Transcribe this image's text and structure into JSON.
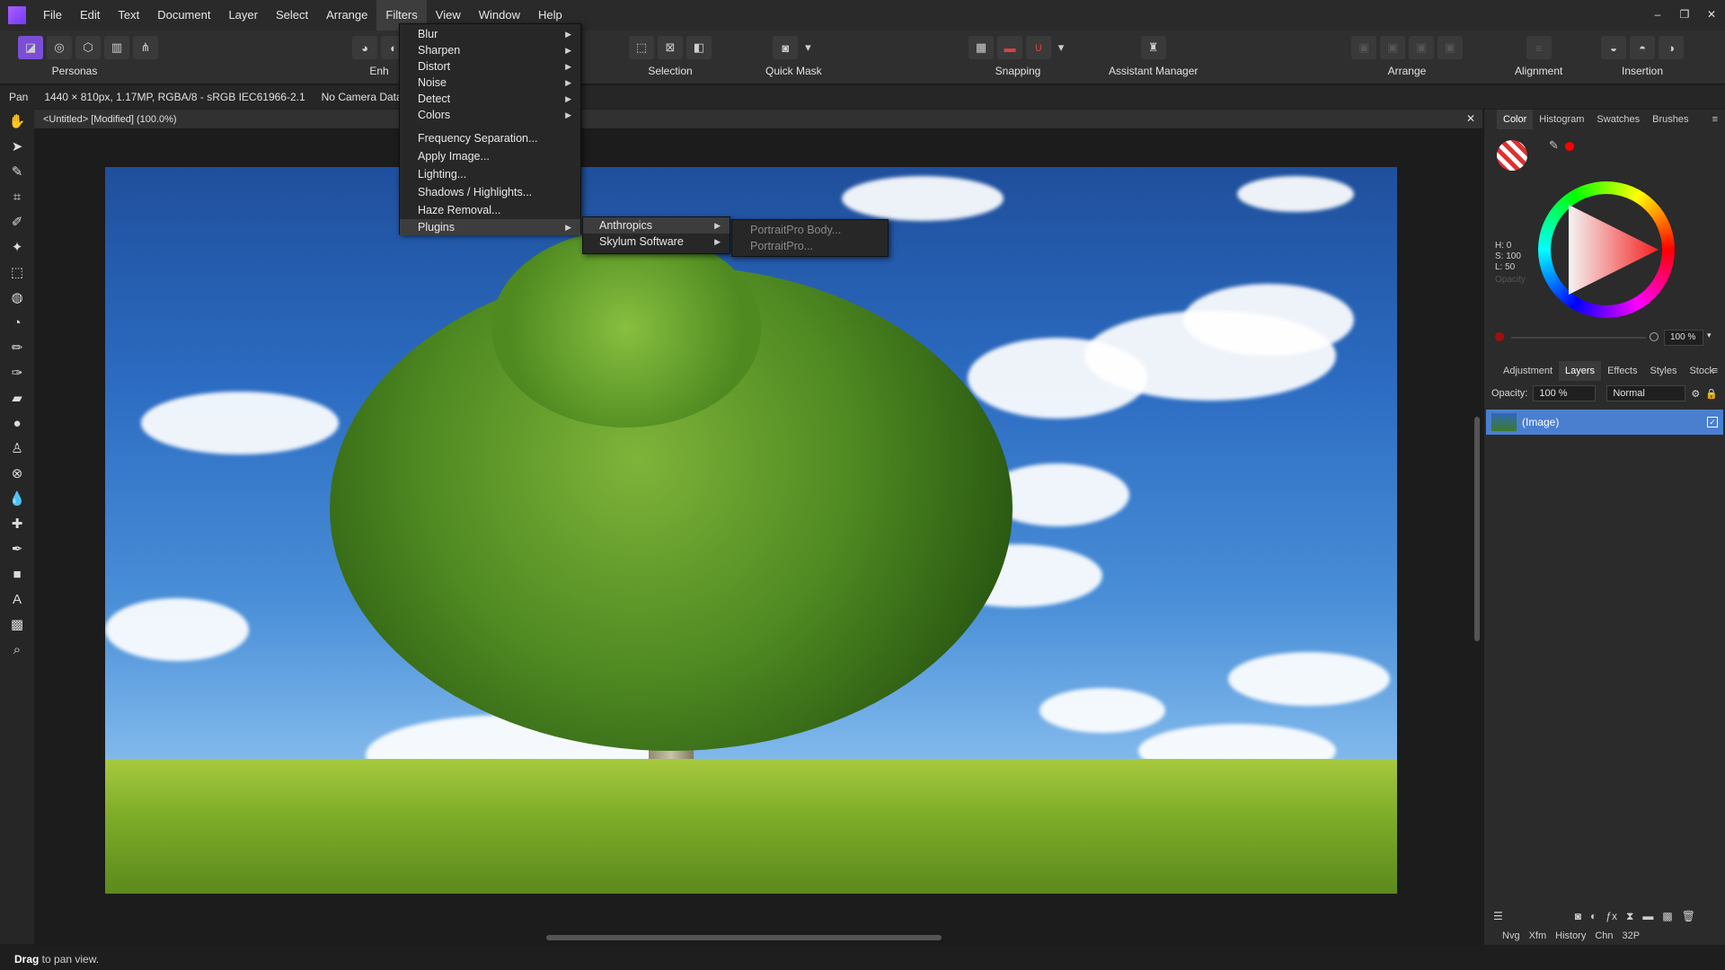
{
  "menubar": {
    "items": [
      "File",
      "Edit",
      "Text",
      "Document",
      "Layer",
      "Select",
      "Arrange",
      "Filters",
      "View",
      "Window",
      "Help"
    ],
    "active": "Filters"
  },
  "window_controls": [
    "–",
    "❐",
    "✕"
  ],
  "toolbar": {
    "personas_label": "Personas",
    "enhance_label": "Enh",
    "selection_label": "Selection",
    "quickmask_label": "Quick Mask",
    "snapping_label": "Snapping",
    "assistant_label": "Assistant Manager",
    "arrange_label": "Arrange",
    "alignment_label": "Alignment",
    "insertion_label": "Insertion"
  },
  "contextbar": {
    "tool": "Pan",
    "doc_info": "1440 × 810px, 1.17MP, RGBA/8 - sRGB IEC61966-2.1",
    "camera": "No Camera Data"
  },
  "document": {
    "tab_title": "<Untitled> [Modified] (100.0%)",
    "close": "✕"
  },
  "filters_menu": {
    "items": [
      "Blur",
      "Sharpen",
      "Distort",
      "Noise",
      "Detect",
      "Colors",
      "Frequency Separation...",
      "Apply Image...",
      "Lighting...",
      "Shadows / Highlights...",
      "Haze Removal...",
      "Plugins"
    ]
  },
  "plugins_submenu": {
    "items": [
      "Anthropics",
      "Skylum Software"
    ]
  },
  "anthropics_submenu": {
    "items": [
      "PortraitPro Body...",
      "PortraitPro..."
    ]
  },
  "color_panel": {
    "tabs": [
      "Color",
      "Histogram",
      "Swatches",
      "Brushes"
    ],
    "active_tab": "Color",
    "h": "H: 0",
    "s": "S: 100",
    "l": "L: 50",
    "opacity_label": "Opacity",
    "opacity_value": "100 %",
    "current_color": "#ff0000"
  },
  "layers_panel": {
    "tabs": [
      "Adjustment",
      "Layers",
      "Effects",
      "Styles",
      "Stock"
    ],
    "active_tab": "Layers",
    "opacity_label": "Opacity:",
    "opacity_value": "100 %",
    "blend_mode": "Normal",
    "layer_name": "(Image)"
  },
  "bottom_tabs": [
    "Nvg",
    "Xfm",
    "History",
    "Chn",
    "32P"
  ],
  "status": {
    "bold": "Drag",
    "text": " to pan view."
  }
}
